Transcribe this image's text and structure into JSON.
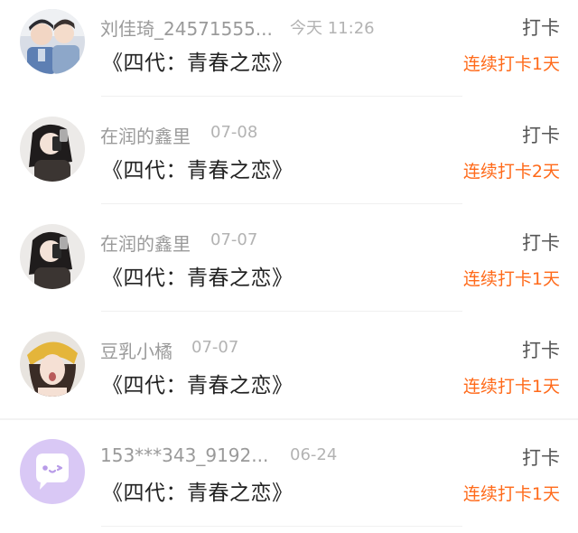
{
  "items": [
    {
      "name": "刘佳琦_24571555...",
      "time": "今天 11:26",
      "title": "《四代：青春之恋》",
      "action": "打卡",
      "streak": "连续打卡1天",
      "avatar_icon": "couple-photo-avatar"
    },
    {
      "name": "在润的鑫里",
      "time": "07-08",
      "title": "《四代：青春之恋》",
      "action": "打卡",
      "streak": "连续打卡2天",
      "avatar_icon": "selfie-photo-avatar"
    },
    {
      "name": "在润的鑫里",
      "time": "07-07",
      "title": "《四代：青春之恋》",
      "action": "打卡",
      "streak": "连续打卡1天",
      "avatar_icon": "selfie-photo-avatar"
    },
    {
      "name": "豆乳小橘",
      "time": "07-07",
      "title": "《四代：青春之恋》",
      "action": "打卡",
      "streak": "连续打卡1天",
      "avatar_icon": "portrait-photo-avatar"
    },
    {
      "name": "153***343_9192...",
      "time": "06-24",
      "title": "《四代：青春之恋》",
      "action": "打卡",
      "streak": "连续打卡1天",
      "avatar_icon": "default-chat-bubble-avatar"
    }
  ],
  "colors": {
    "streak": "#ff6a1a",
    "name": "#9a9a9a",
    "title": "#222222",
    "default_avatar_bg": "#d9c8f5"
  }
}
